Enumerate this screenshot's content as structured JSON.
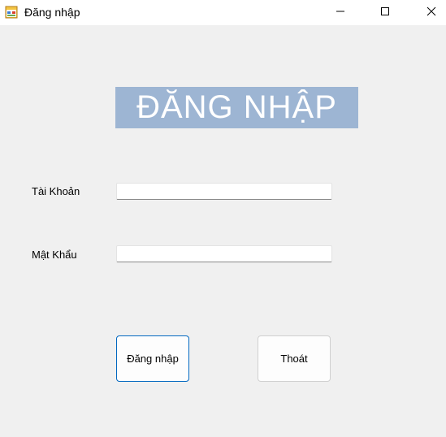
{
  "window": {
    "title": "Đăng nhập",
    "app_icon": "form-app-icon",
    "controls": {
      "minimize_icon": "minimize-icon",
      "maximize_icon": "maximize-icon",
      "close_icon": "close-icon"
    }
  },
  "form": {
    "heading": "ĐĂNG NHẬP",
    "heading_bg": "#9db5d3",
    "username": {
      "label": "Tài Khoản",
      "value": ""
    },
    "password": {
      "label": "Mật Khẩu",
      "value": ""
    },
    "buttons": {
      "login": "Đăng nhập",
      "exit": "Thoát"
    },
    "accent": "#0067c0"
  }
}
